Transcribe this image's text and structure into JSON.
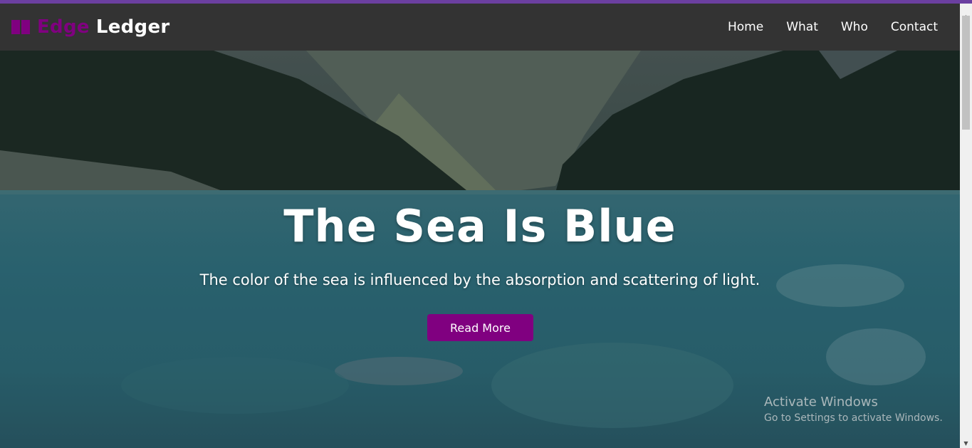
{
  "brand": {
    "icon": "book-icon",
    "name_accent": "Edge",
    "name_main": "Ledger",
    "accent_color": "#800080"
  },
  "nav": {
    "items": [
      {
        "label": "Home"
      },
      {
        "label": "What"
      },
      {
        "label": "Who"
      },
      {
        "label": "Contact"
      }
    ]
  },
  "hero": {
    "title": "The Sea Is Blue",
    "subtitle": "The color of the sea is influenced by the absorption and scattering of light.",
    "button_label": "Read More",
    "button_color": "#800080"
  },
  "watermark": {
    "title": "Activate Windows",
    "subtitle": "Go to Settings to activate Windows."
  },
  "colors": {
    "navbar_bg": "#333333",
    "top_accent_line": "#6b3fa0"
  }
}
